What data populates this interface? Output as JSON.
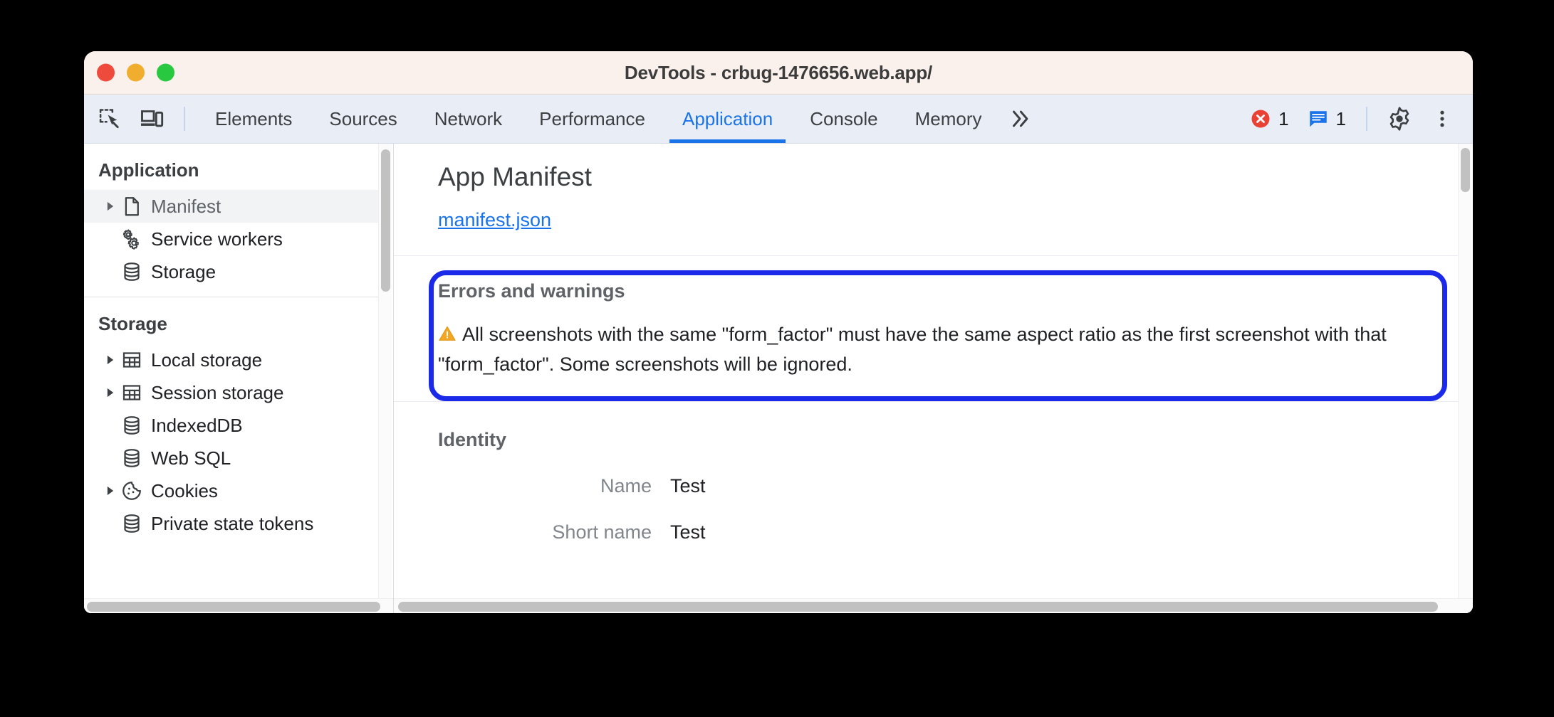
{
  "window": {
    "title": "DevTools - crbug-1476656.web.app/",
    "traffic_lights": {
      "close": "close-button",
      "minimize": "minimize-button",
      "maximize": "maximize-button"
    }
  },
  "toolbar": {
    "inspect_icon": "inspect-element-icon",
    "device_icon": "device-toolbar-icon",
    "tabs": [
      {
        "label": "Elements",
        "active": false
      },
      {
        "label": "Sources",
        "active": false
      },
      {
        "label": "Network",
        "active": false
      },
      {
        "label": "Performance",
        "active": false
      },
      {
        "label": "Application",
        "active": true
      },
      {
        "label": "Console",
        "active": false
      },
      {
        "label": "Memory",
        "active": false
      }
    ],
    "more_tabs_icon": "chevron-double-right-icon",
    "error_count": "1",
    "error_icon": "error-circle-icon",
    "message_count": "1",
    "message_icon": "message-bubble-icon",
    "settings_icon": "gear-icon",
    "menu_icon": "three-dot-menu-icon"
  },
  "sidebar": {
    "groups": [
      {
        "title": "Application",
        "items": [
          {
            "label": "Manifest",
            "icon": "document-icon",
            "expandable": true,
            "selected": true
          },
          {
            "label": "Service workers",
            "icon": "gears-icon",
            "expandable": false,
            "selected": false
          },
          {
            "label": "Storage",
            "icon": "database-icon",
            "expandable": false,
            "selected": false
          }
        ]
      },
      {
        "title": "Storage",
        "items": [
          {
            "label": "Local storage",
            "icon": "table-icon",
            "expandable": true,
            "selected": false
          },
          {
            "label": "Session storage",
            "icon": "table-icon",
            "expandable": true,
            "selected": false
          },
          {
            "label": "IndexedDB",
            "icon": "database-icon",
            "expandable": false,
            "selected": false
          },
          {
            "label": "Web SQL",
            "icon": "database-icon",
            "expandable": false,
            "selected": false
          },
          {
            "label": "Cookies",
            "icon": "cookie-icon",
            "expandable": true,
            "selected": false
          },
          {
            "label": "Private state tokens",
            "icon": "database-icon",
            "expandable": false,
            "selected": false
          }
        ]
      }
    ]
  },
  "main": {
    "page_title": "App Manifest",
    "manifest_link": "manifest.json",
    "errors": {
      "title": "Errors and warnings",
      "warning_icon": "warning-triangle-icon",
      "message": "All screenshots with the same \"form_factor\" must have the same aspect ratio as the first screenshot with that \"form_factor\". Some screenshots will be ignored."
    },
    "identity": {
      "title": "Identity",
      "rows": [
        {
          "key": "Name",
          "value": "Test"
        },
        {
          "key": "Short name",
          "value": "Test"
        }
      ]
    }
  },
  "colors": {
    "accent_blue": "#1a73e8",
    "highlight_blue": "#1a2ae8",
    "warning_orange": "#f5a623",
    "error_red": "#e94235",
    "titlebar_bg": "#faf1ec",
    "tabbar_bg": "#e9eef6"
  }
}
